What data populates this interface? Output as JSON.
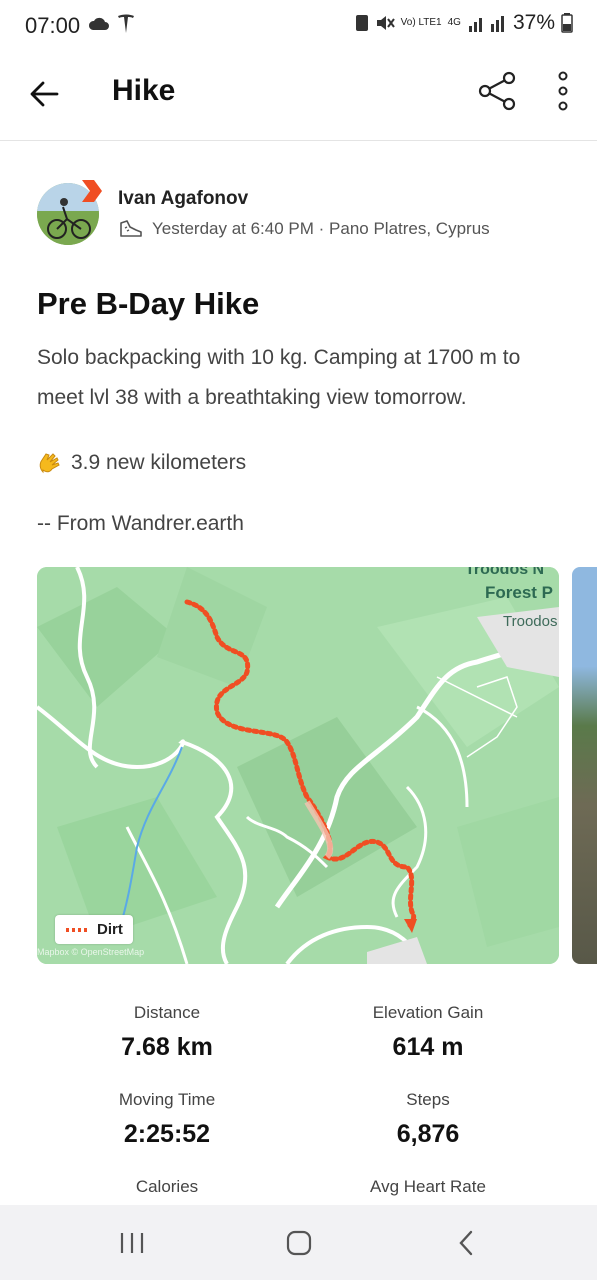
{
  "status_bar": {
    "time": "07:00",
    "network_volte": "Vo) LTE1",
    "network_4g": "4G",
    "battery": "37%",
    "icons": [
      "cloud-icon",
      "tesla-icon",
      "sim-icon",
      "mute-icon",
      "signal-icon",
      "battery-icon"
    ]
  },
  "header": {
    "title": "Hike",
    "icons": [
      "back-arrow-icon",
      "share-icon",
      "more-vert-icon"
    ]
  },
  "athlete": {
    "name": "Ivan Agafonov",
    "meta": "Yesterday at 6:40 PM · Pano Platres, Cyprus",
    "activity_icon": "hiking-shoe-icon"
  },
  "activity": {
    "title": "Pre B-Day Hike",
    "description": "Solo backpacking with 10 kg. Camping at 1700 m to meet lvl 38 with a breathtaking view tomorrow.",
    "new_km": "3.9 new kilometers",
    "from": "-- From Wandrer.earth"
  },
  "map": {
    "legend_label": "Dirt",
    "place_label_1": "Troodos N",
    "place_label_2": "Forest P",
    "place_label_3": "Troodos",
    "attribution": "Mapbox © OpenStreetMap",
    "colors": {
      "land": "#a6dba9",
      "route": "#f04e23",
      "road": "#ffffff",
      "water": "#5aa9e6"
    }
  },
  "stats": [
    {
      "label": "Distance",
      "value": "7.68 km"
    },
    {
      "label": "Elevation Gain",
      "value": "614 m"
    },
    {
      "label": "Moving Time",
      "value": "2:25:52"
    },
    {
      "label": "Steps",
      "value": "6,876"
    },
    {
      "label": "Calories",
      "value": ""
    },
    {
      "label": "Avg Heart Rate",
      "value": ""
    }
  ],
  "nav_bar": {
    "icons": [
      "recents-icon",
      "home-icon",
      "back-icon"
    ]
  }
}
